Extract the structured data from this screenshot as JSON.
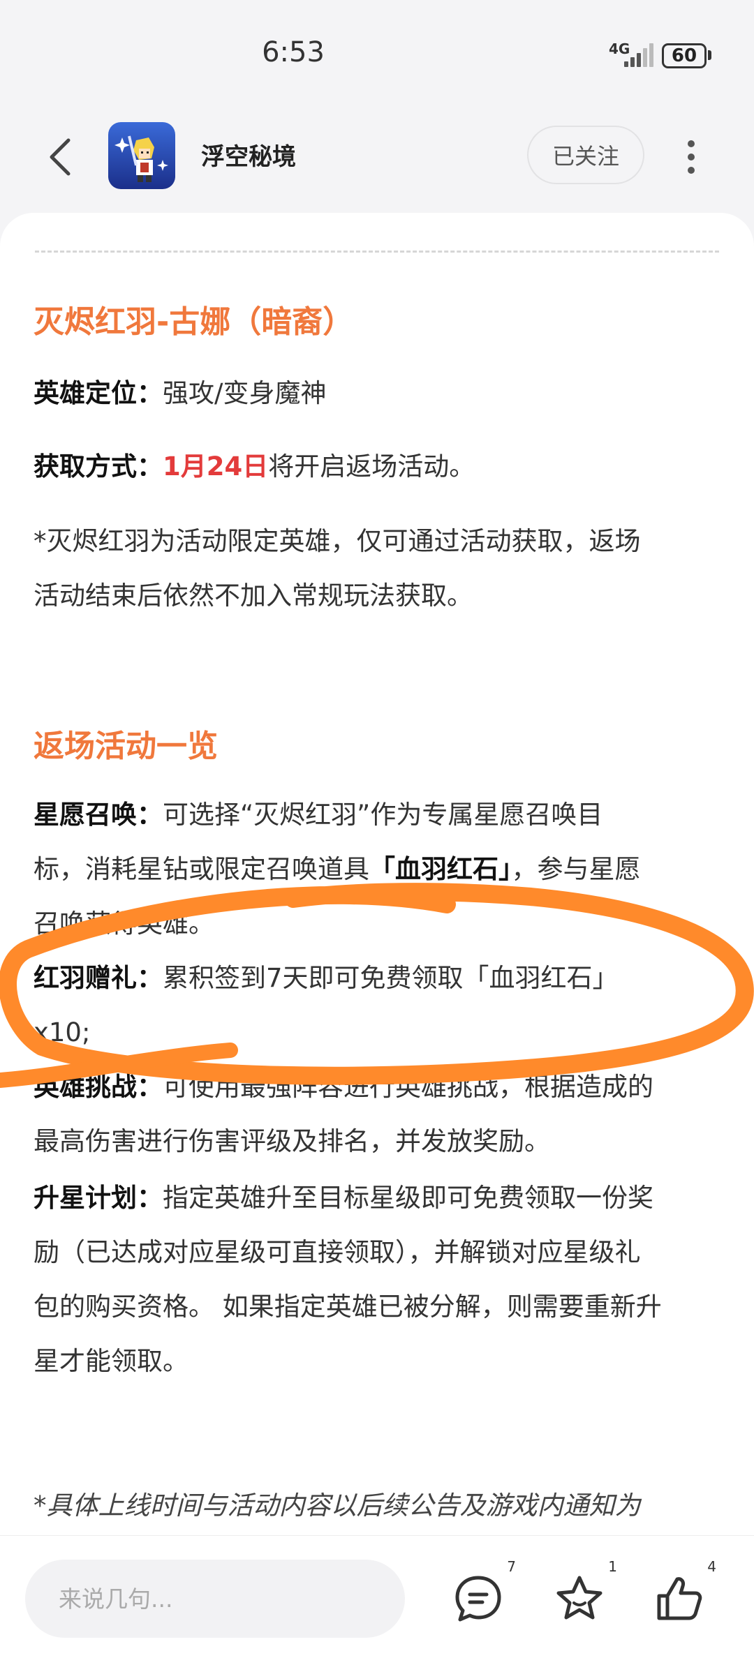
{
  "status_bar": {
    "time": "6:53",
    "network": "4G",
    "battery": "60"
  },
  "header": {
    "app_name": "浮空秘境",
    "follow_label": "已关注"
  },
  "sections": {
    "hero_title": "灭烬红羽-古娜（暗裔）",
    "role_label": "英雄定位：",
    "role_value": "强攻/变身魔神",
    "acquire_label": "获取方式：",
    "acquire_date": "1月24日",
    "acquire_rest": "将开启返场活动。",
    "note_line1": "*灭烬红羽为活动限定英雄，仅可通过活动获取，返场",
    "note_line2": "活动结束后依然不加入常规玩法获取。",
    "events_title": "返场活动一览",
    "wish_label": "星愿召唤：",
    "wish_text1": "可选择“灭烬红羽”作为专属星愿召唤目",
    "wish_text2": "标，消耗星钻或限定召唤道具",
    "wish_item": "「血羽红石」",
    "wish_text3": "，参与星愿",
    "wish_text4": "召唤获得英雄。",
    "gift_label": "红羽赠礼：",
    "gift_text1": "累积签到7天即可免费领取「血羽红石」",
    "gift_text2": "x10;",
    "challenge_label": "英雄挑战：",
    "challenge_text1": "可使用最强阵容进行英雄挑战，根据造成的",
    "challenge_text2": "最高伤害进行伤害评级及排名，并发放奖励。",
    "star_label": "升星计划：",
    "star_text1": "指定英雄升至目标星级即可免费领取一份奖",
    "star_text2": "励（已达成对应星级可直接领取），并解锁对应星级礼",
    "star_text3": "包的购买资格。 如果指定英雄已被分解，则需要重新升",
    "star_text4": "星才能领取。",
    "footnote": "*具体上线时间与活动内容以后续公告及游戏内通知为"
  },
  "bottom_bar": {
    "comment_placeholder": "来说几句...",
    "comment_count": "7",
    "favorite_count": "1",
    "like_count": "4"
  },
  "colors": {
    "accent": "#f0783c",
    "highlight_red": "#e33b3b",
    "scribble": "#ff8a2b"
  },
  "icons": [
    "back-chevron-icon",
    "app-logo-icon",
    "more-vertical-icon",
    "comment-icon",
    "star-icon",
    "thumbs-up-icon"
  ]
}
